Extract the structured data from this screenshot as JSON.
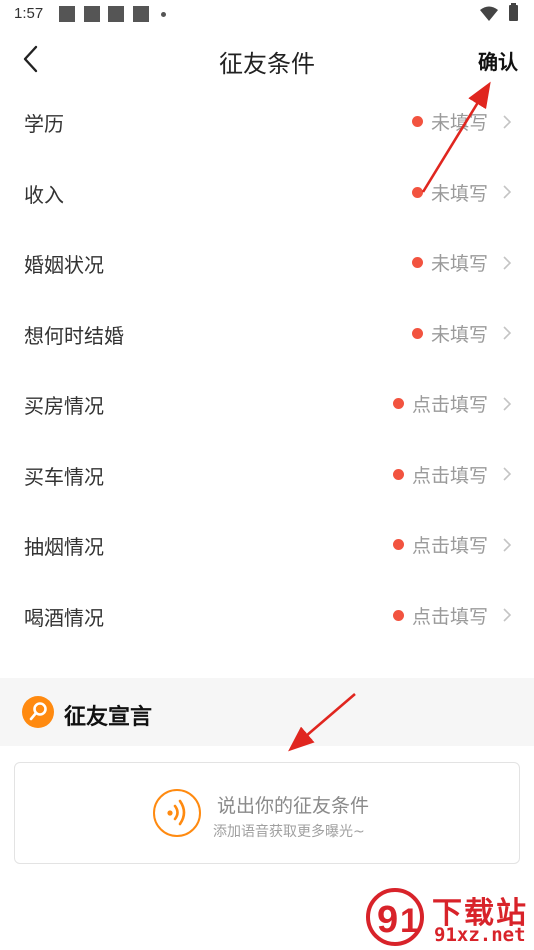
{
  "status_bar": {
    "time": "1:57"
  },
  "header": {
    "title": "征友条件",
    "confirm_label": "确认"
  },
  "conditions": [
    {
      "label": "学历",
      "value": "未填写"
    },
    {
      "label": "收入",
      "value": "未填写"
    },
    {
      "label": "婚姻状况",
      "value": "未填写"
    },
    {
      "label": "想何时结婚",
      "value": "未填写"
    },
    {
      "label": "买房情况",
      "value": "点击填写"
    },
    {
      "label": "买车情况",
      "value": "点击填写"
    },
    {
      "label": "抽烟情况",
      "value": "点击填写"
    },
    {
      "label": "喝酒情况",
      "value": "点击填写"
    }
  ],
  "declaration": {
    "title": "征友宣言",
    "voice_title": "说出你的征友条件",
    "voice_subtitle": "添加语音获取更多曝光~"
  },
  "watermark": {
    "top": "下载站",
    "bottom": "91xz.net"
  },
  "colors": {
    "accent": "#ff8a10",
    "status_dot": "#f2533f",
    "annotation": "#e0261f",
    "watermark": "#d8232a"
  }
}
